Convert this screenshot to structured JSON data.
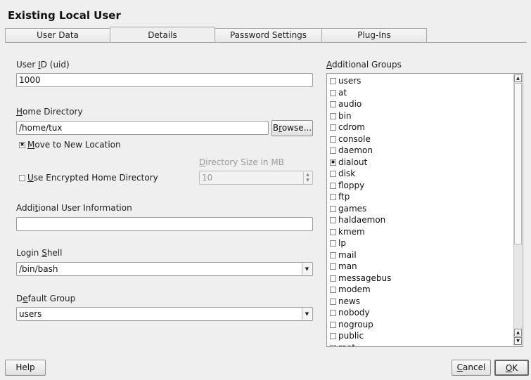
{
  "window": {
    "title": "Existing Local User"
  },
  "tabs": [
    {
      "label": "User Data"
    },
    {
      "label": "Details"
    },
    {
      "label": "Password Settings"
    },
    {
      "label": "Plug-Ins"
    }
  ],
  "details": {
    "uid": {
      "label_pre": "User ",
      "label_key": "I",
      "label_post": "D (uid)",
      "value": "1000"
    },
    "home": {
      "label_key": "H",
      "label_post": "ome Directory",
      "value": "/home/tux",
      "browse_pre": "B",
      "browse_key": "r",
      "browse_post": "owse..."
    },
    "move": {
      "label_key": "M",
      "label_post": "ove to New Location",
      "checked": true
    },
    "encrypted": {
      "label_key": "U",
      "label_post": "se Encrypted Home Directory",
      "checked": false
    },
    "dir_size": {
      "label_key": "D",
      "label_post": "irectory Size in MB",
      "value": "10"
    },
    "additional_info": {
      "label_pre": "Addi",
      "label_key": "t",
      "label_post": "ional User Information",
      "value": ""
    },
    "login_shell": {
      "label_pre": "Login ",
      "label_key": "S",
      "label_post": "hell",
      "value": "/bin/bash"
    },
    "default_group": {
      "label_pre": "D",
      "label_key": "e",
      "label_post": "fault Group",
      "value": "users"
    }
  },
  "groups": {
    "label_key": "A",
    "label_post": "dditional Groups",
    "items": [
      {
        "name": "users",
        "checked": false
      },
      {
        "name": "at",
        "checked": false
      },
      {
        "name": "audio",
        "checked": false
      },
      {
        "name": "bin",
        "checked": false
      },
      {
        "name": "cdrom",
        "checked": false
      },
      {
        "name": "console",
        "checked": false
      },
      {
        "name": "daemon",
        "checked": false
      },
      {
        "name": "dialout",
        "checked": true
      },
      {
        "name": "disk",
        "checked": false
      },
      {
        "name": "floppy",
        "checked": false
      },
      {
        "name": "ftp",
        "checked": false
      },
      {
        "name": "games",
        "checked": false
      },
      {
        "name": "haldaemon",
        "checked": false
      },
      {
        "name": "kmem",
        "checked": false
      },
      {
        "name": "lp",
        "checked": false
      },
      {
        "name": "mail",
        "checked": false
      },
      {
        "name": "man",
        "checked": false
      },
      {
        "name": "messagebus",
        "checked": false
      },
      {
        "name": "modem",
        "checked": false
      },
      {
        "name": "news",
        "checked": false
      },
      {
        "name": "nobody",
        "checked": false
      },
      {
        "name": "nogroup",
        "checked": false
      },
      {
        "name": "public",
        "checked": false
      },
      {
        "name": "root",
        "checked": false
      }
    ]
  },
  "buttons": {
    "help": "Help",
    "cancel_key": "C",
    "cancel_post": "ancel",
    "ok_key": "O",
    "ok_post": "K"
  }
}
